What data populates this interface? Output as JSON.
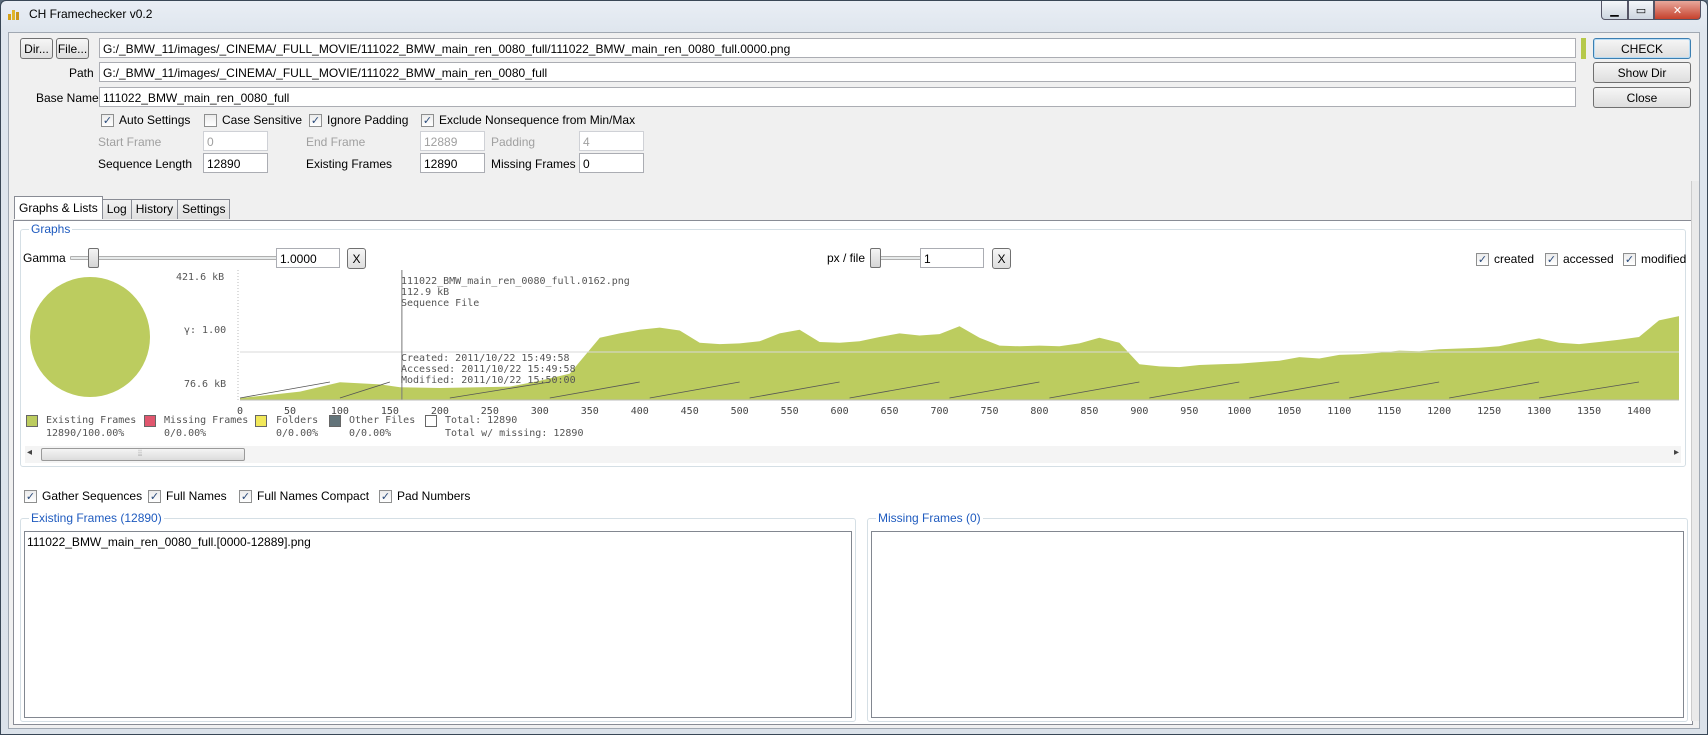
{
  "window": {
    "title": "CH Framechecker v0.2"
  },
  "buttons": {
    "dir": "Dir...",
    "file": "File...",
    "check": "CHECK",
    "show_dir": "Show Dir",
    "close": "Close"
  },
  "file_field": {
    "value": "G:/_BMW_11/images/_CINEMA/_FULL_MOVIE/111022_BMW_main_ren_0080_full/111022_BMW_main_ren_0080_full.0000.png"
  },
  "path": {
    "label": "Path",
    "value": "G:/_BMW_11/images/_CINEMA/_FULL_MOVIE/111022_BMW_main_ren_0080_full"
  },
  "base_name": {
    "label": "Base Name",
    "value": "111022_BMW_main_ren_0080_full"
  },
  "options": {
    "auto_settings": "Auto Settings",
    "case_sensitive": "Case Sensitive",
    "ignore_padding": "Ignore Padding",
    "exclude_nonsequence": "Exclude Nonsequence from Min/Max"
  },
  "frames": {
    "start_frame_label": "Start Frame",
    "start_frame": "0",
    "end_frame_label": "End Frame",
    "end_frame": "12889",
    "padding_label": "Padding",
    "padding": "4",
    "sequence_length_label": "Sequence Length",
    "sequence_length": "12890",
    "existing_frames_label": "Existing Frames",
    "existing_frames": "12890",
    "missing_frames_label": "Missing Frames",
    "missing_frames": "0"
  },
  "tabs": [
    {
      "label": "Graphs & Lists"
    },
    {
      "label": "Log"
    },
    {
      "label": "History"
    },
    {
      "label": "Settings"
    }
  ],
  "graphs": {
    "title": "Graphs",
    "gamma_label": "Gamma",
    "gamma_value": "1.0000",
    "reset": "X",
    "px_file_label": "px / file",
    "px_file_value": "1",
    "created": "created",
    "accessed": "accessed",
    "modified": "modified",
    "y_top": "421.6 kB",
    "y_mid": "γ: 1.00",
    "y_bottom": "76.6 kB",
    "tooltip": {
      "file": "111022_BMW_main_ren_0080_full.0162.png",
      "size": "112.9 kB",
      "kind": "Sequence File",
      "created": "Created:  2011/10/22 15:49:58",
      "accessed": "Accessed: 2011/10/22 15:49:58",
      "modified": "Modified: 2011/10/22 15:50:00"
    },
    "legend": {
      "existing": "Existing Frames",
      "existing_val": "12890/100.00%",
      "missing": "Missing Frames",
      "missing_val": "0/0.00%",
      "folders": "Folders",
      "folders_val": "0/0.00%",
      "other": "Other Files",
      "other_val": "0/0.00%",
      "total": "Total: 12890",
      "total_missing": "Total w/ missing: 12890"
    },
    "colors": {
      "existing": "#bccc5f",
      "missing": "#e0566e",
      "folders": "#f1e85a",
      "other": "#63747a",
      "total": "#ffffff"
    }
  },
  "chart_data": {
    "type": "area",
    "x_ticks": [
      "0",
      "50",
      "100",
      "150",
      "200",
      "250",
      "300",
      "350",
      "400",
      "450",
      "500",
      "550",
      "600",
      "650",
      "700",
      "750",
      "800",
      "850",
      "900",
      "950",
      "1000",
      "1050",
      "1100",
      "1150",
      "1200",
      "1250",
      "1300",
      "1350",
      "1400"
    ],
    "xlim": [
      0,
      1440
    ],
    "ylim": [
      76.6,
      421.6
    ],
    "series": [
      {
        "x": [
          0,
          60,
          100,
          140,
          160,
          200,
          240,
          270,
          300,
          330,
          345,
          360,
          380,
          400,
          420,
          440,
          460,
          480,
          500,
          520,
          540,
          560,
          580,
          600,
          620,
          640,
          660,
          680,
          700,
          720,
          740,
          760,
          780,
          800,
          820,
          840,
          860,
          880,
          900,
          920,
          940,
          960,
          980,
          1000,
          1020,
          1040,
          1060,
          1080,
          1100,
          1120,
          1140,
          1160,
          1180,
          1200,
          1220,
          1240,
          1260,
          1280,
          1300,
          1320,
          1340,
          1360,
          1380,
          1400,
          1420,
          1440
        ],
        "y": [
          82,
          100,
          126,
          120,
          112,
          110,
          112,
          114,
          130,
          150,
          200,
          250,
          262,
          272,
          278,
          270,
          236,
          232,
          234,
          240,
          262,
          272,
          238,
          236,
          240,
          252,
          262,
          256,
          260,
          282,
          250,
          228,
          226,
          228,
          226,
          234,
          250,
          236,
          176,
          170,
          168,
          174,
          176,
          178,
          182,
          186,
          196,
          192,
          202,
          204,
          208,
          214,
          212,
          218,
          220,
          222,
          226,
          238,
          248,
          236,
          232,
          238,
          244,
          252,
          298,
          310
        ]
      }
    ]
  },
  "list_options": {
    "gather_sequences": "Gather Sequences",
    "full_names": "Full Names",
    "full_names_compact": "Full Names Compact",
    "pad_numbers": "Pad Numbers"
  },
  "lists": {
    "existing_title": "Existing Frames (12890)",
    "existing_items": [
      "111022_BMW_main_ren_0080_full.[0000-12889].png"
    ],
    "missing_title": "Missing Frames (0)"
  }
}
